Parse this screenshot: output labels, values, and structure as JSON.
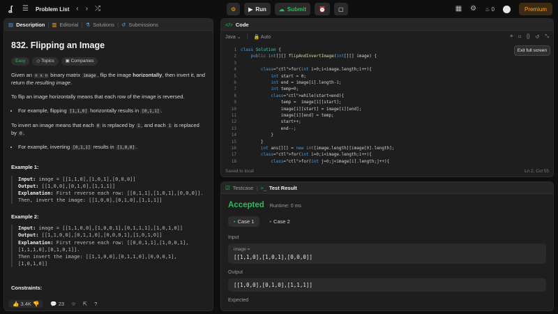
{
  "topbar": {
    "problem_list": "Problem List",
    "run": "Run",
    "submit": "Submit",
    "streak": "0",
    "premium": "Premium"
  },
  "left": {
    "tabs": {
      "description": "Description",
      "editorial": "Editorial",
      "solutions": "Solutions",
      "submissions": "Submissions"
    },
    "title": "832. Flipping an Image",
    "tags": {
      "difficulty": "Easy",
      "topics": "Topics",
      "companies": "Companies"
    },
    "p1": {
      "a": "Given an",
      "nxn": "n x n",
      "b": "binary matrix",
      "image": "image",
      ", flip the image": "",
      "c": ", flip the image",
      "horiz": "horizontally",
      ", then invert it, and return ": "",
      "d": ", then invert it, and return",
      "result": "the resulting image",
      "e": "."
    },
    "p2": "To flip an image horizontally means that each row of the image is reversed.",
    "li1": {
      "a": "For example, flipping",
      "code1": "[1,1,0]",
      "b": "horizontally results in",
      "code2": "[0,1,1]",
      "c": "."
    },
    "p3": {
      "a": "To invert an image means that each",
      "z": "0",
      "b": "is replaced by",
      "o": "1",
      ", and each": "",
      "c": ", and each",
      "o2": "1",
      "d": "is replaced by",
      "z2": "0",
      "e": "."
    },
    "li2": {
      "a": "For example, inverting",
      "code1": "[0,1,1]",
      "b": "results in",
      "code2": "[1,0,0]",
      "c": "."
    },
    "ex1": {
      "title": "Example 1:",
      "input_label": "Input:",
      "input": "image = [[1,1,0],[1,0,1],[0,0,0]]",
      "output_label": "Output:",
      "output": "[[1,0,0],[0,1,0],[1,1,1]]",
      "expl_label": "Explanation:",
      "expl": "First reverse each row: [[0,1,1],[1,0,1],[0,0,0]].\nThen, invert the image: [[1,0,0],[0,1,0],[1,1,1]]"
    },
    "ex2": {
      "title": "Example 2:",
      "input_label": "Input:",
      "input": "image = [[1,1,0,0],[1,0,0,1],[0,1,1,1],[1,0,1,0]]",
      "output_label": "Output:",
      "output": "[[1,1,0,0],[0,1,1,0],[0,0,0,1],[1,0,1,0]]",
      "expl_label": "Explanation:",
      "expl": "First reverse each row: [[0,0,1,1],[1,0,0,1],[1,1,1,0],[0,1,0,1]].\nThen invert the image: [[1,1,0,0],[0,1,1,0],[0,0,0,1],[1,0,1,0]]"
    },
    "constraints": "Constraints:",
    "footer": {
      "likes": "3.4K",
      "comments": "23"
    }
  },
  "code": {
    "tab": "Code",
    "lang": "Java",
    "auto": "Auto",
    "tooltip": "Exit full screen",
    "saved": "Saved to local",
    "cursor": "Ln 2, Col 55",
    "lines": [
      "class Solution {",
      "    public int[][] flipAndInvertImage(int[][] image) {",
      "",
      "        for(int i=0;i<image.length;i++){",
      "            int start = 0;",
      "            int end = image[i].length-1;",
      "            int temp=0;",
      "            while(start<end){",
      "                temp =  image[i][start];",
      "                image[i][start] = image[i][end];",
      "                image[i][end] = temp;",
      "                start++;",
      "                end--;",
      "            }",
      "        }",
      "        int ans[][] = new int[image.length][image[0].length];",
      "        for(int i=0;i<image.length;i++){",
      "            for(int j=0;j<image[i].length;j++){"
    ]
  },
  "result": {
    "tabs": {
      "testcase": "Testcase",
      "result": "Test Result"
    },
    "status": "Accepted",
    "runtime": "Runtime: 0 ms",
    "cases": [
      "Case 1",
      "Case 2"
    ],
    "input_label": "Input",
    "image_label": "image =",
    "input_value": "[[1,1,0],[1,0,1],[0,0,0]]",
    "output_label": "Output",
    "output_value": "[[1,0,0],[0,1,0],[1,1,1]]",
    "expected_label": "Expected"
  }
}
